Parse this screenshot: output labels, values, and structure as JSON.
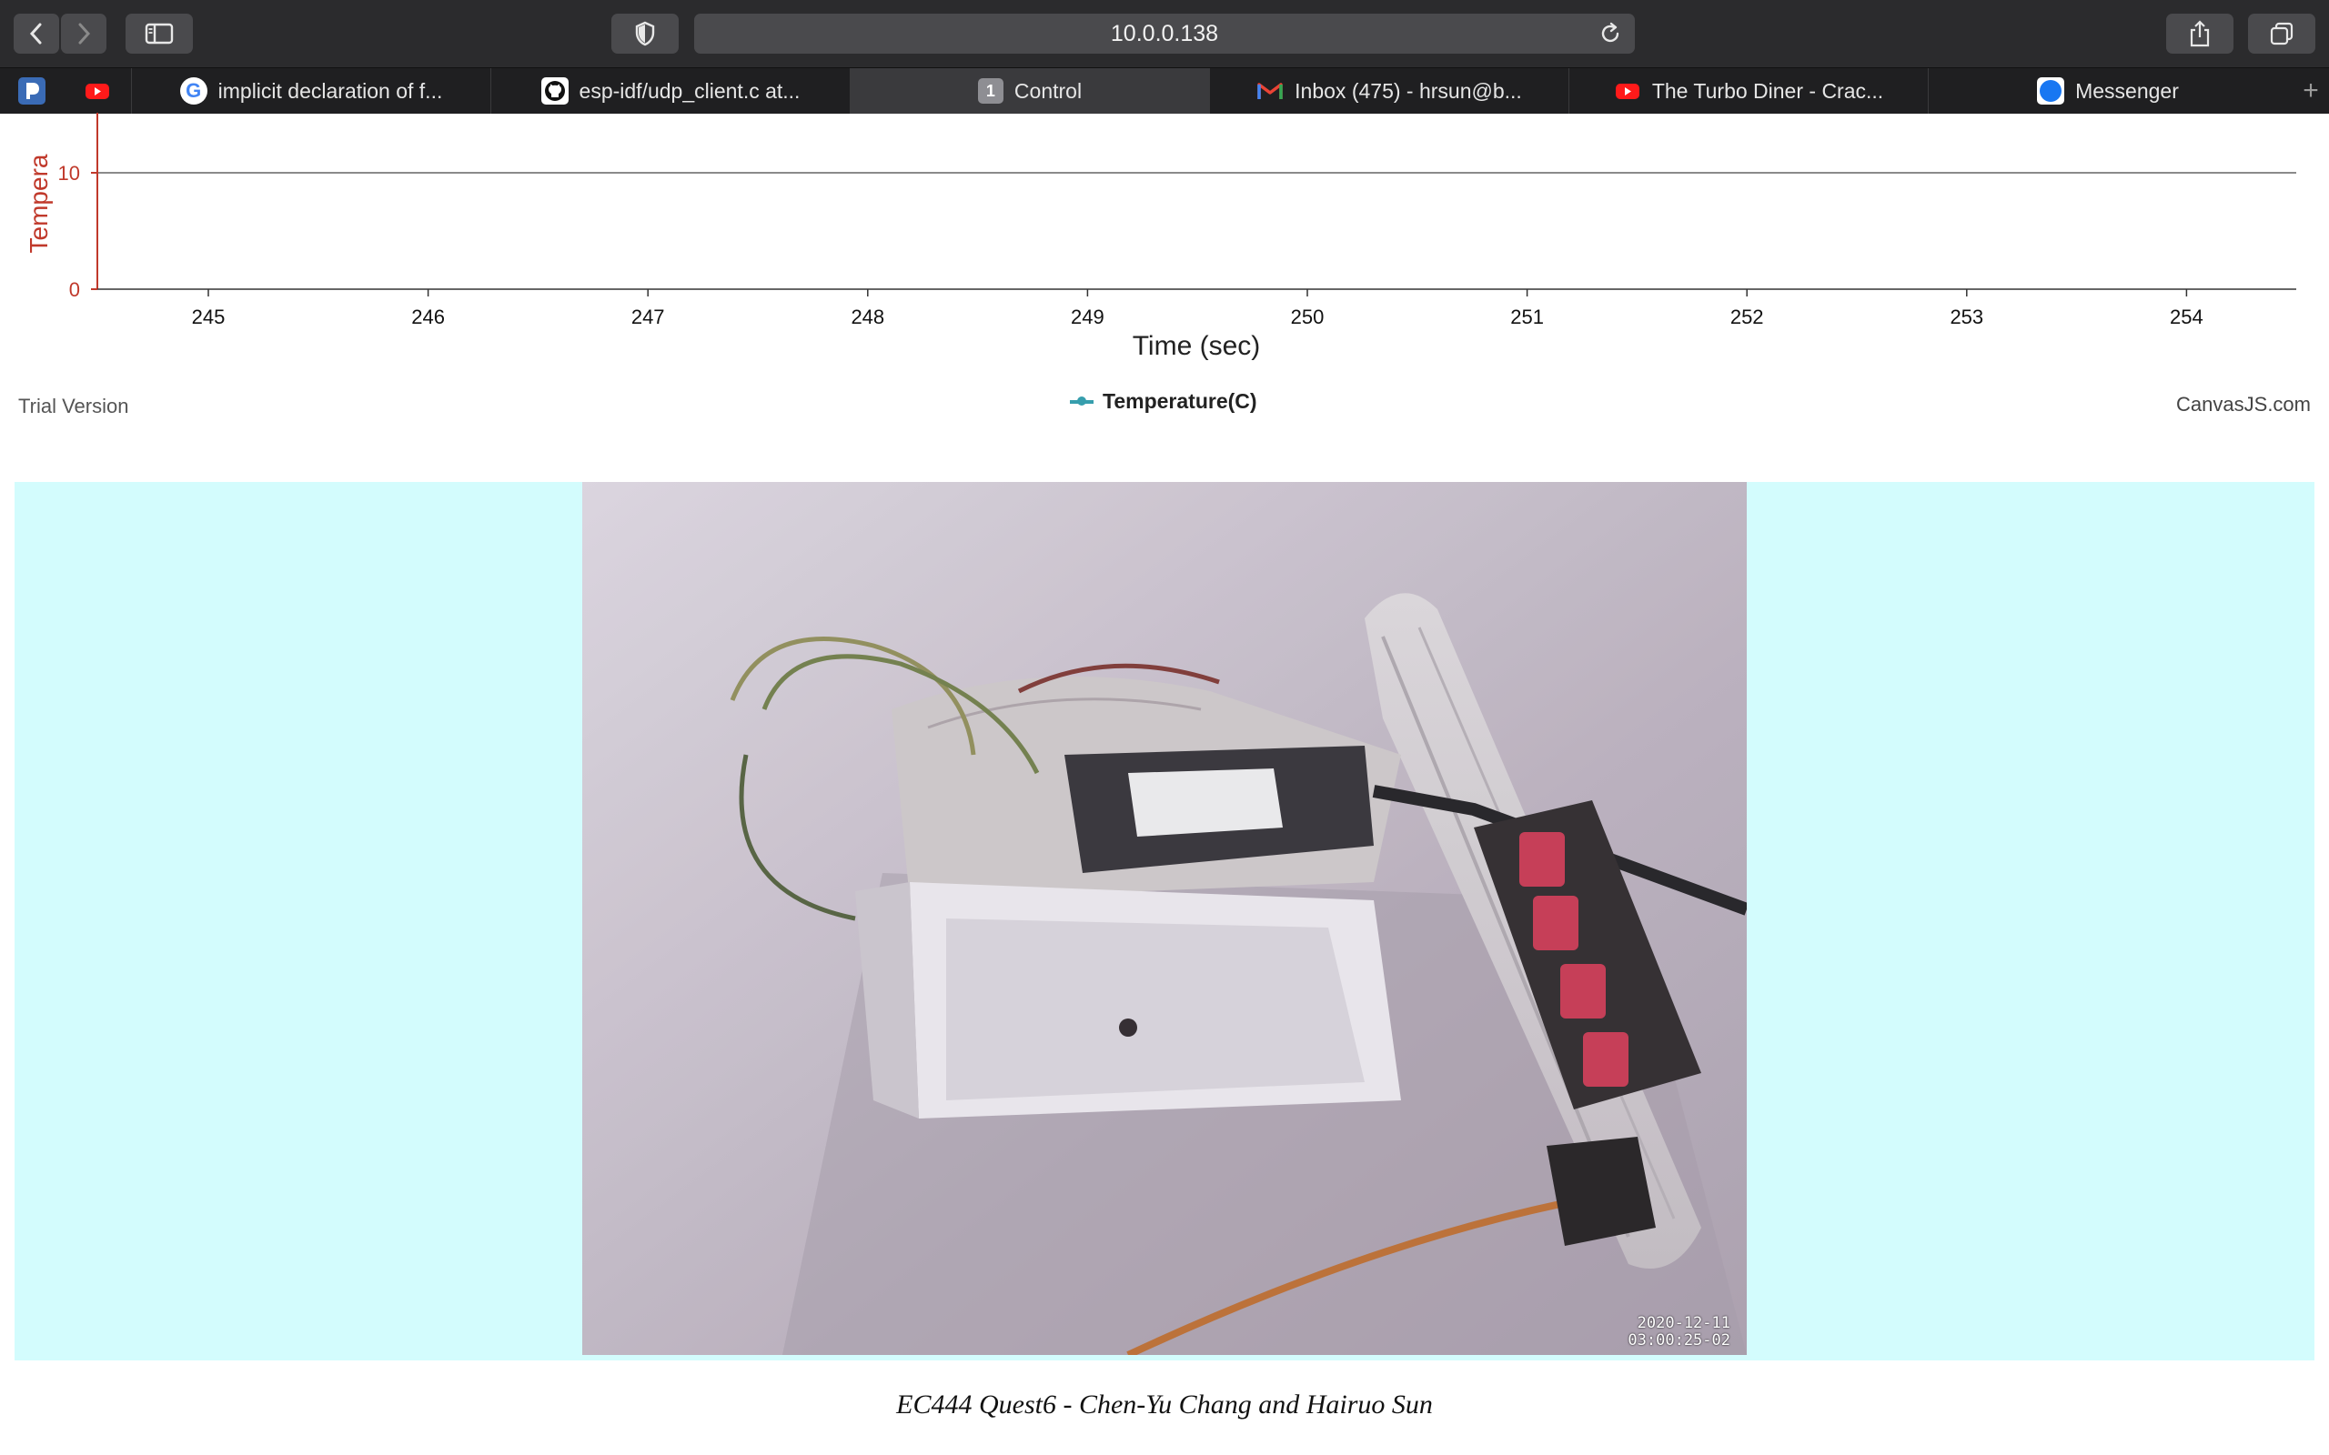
{
  "browser": {
    "url": "10.0.0.138",
    "tabs": [
      {
        "label": "implicit declaration of f...",
        "icon": "google-icon",
        "active": false
      },
      {
        "label": "esp-idf/udp_client.c at...",
        "icon": "github-icon",
        "active": false
      },
      {
        "label": "Control",
        "icon": "numbered-tab-icon",
        "icon_text": "1",
        "active": true
      },
      {
        "label": "Inbox (475) - hrsun@b...",
        "icon": "gmail-icon",
        "active": false
      },
      {
        "label": "The Turbo Diner - Crac...",
        "icon": "youtube-icon",
        "active": false
      },
      {
        "label": "Messenger",
        "icon": "messenger-icon",
        "active": false
      }
    ],
    "pinned": [
      "pandora-icon",
      "youtube-icon"
    ]
  },
  "chart_data": {
    "type": "line",
    "xlabel": "Time (sec)",
    "ylabel": "Tempera",
    "x_ticks": [
      "245",
      "246",
      "247",
      "248",
      "249",
      "250",
      "251",
      "252",
      "253",
      "254"
    ],
    "y_ticks": [
      "0",
      "10"
    ],
    "series": [
      {
        "name": "Temperature(C)",
        "values": []
      }
    ],
    "grid": "horizontal",
    "legend": "bottom-center",
    "colors": {
      "axis_y": "#c0392b",
      "series": "#369ead"
    }
  },
  "chart_credits": {
    "left": "Trial Version",
    "right": "CanvasJS.com"
  },
  "camera": {
    "timestamp_date": "2020-12-11",
    "timestamp_time": "03:00:25-02"
  },
  "footer": {
    "text": "EC444 Quest6 - Chen-Yu Chang and Hairuo Sun"
  }
}
